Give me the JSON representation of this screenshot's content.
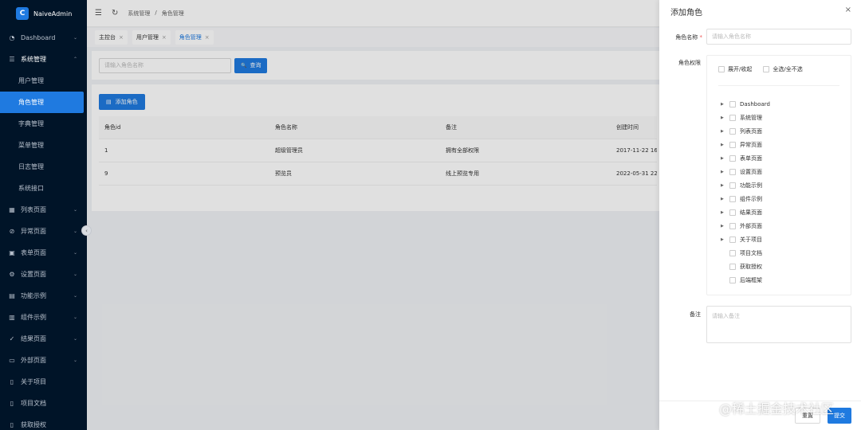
{
  "app": {
    "name": "NaiveAdmin",
    "logo_letter": "C"
  },
  "sidebar": {
    "items": [
      {
        "label": "Dashboard",
        "icon": "dashboard-icon",
        "glyph": "◔",
        "arrow": "⌄"
      },
      {
        "label": "系统管理",
        "icon": "settings-sliders-icon",
        "glyph": "☰",
        "arrow": "⌃",
        "open": true,
        "children": [
          "用户管理",
          "角色管理",
          "字典管理",
          "菜单管理",
          "日志管理",
          "系统接口"
        ],
        "active_child": 1
      },
      {
        "label": "列表页面",
        "icon": "table-icon",
        "glyph": "▦",
        "arrow": "⌄"
      },
      {
        "label": "异常页面",
        "icon": "warning-circle-icon",
        "glyph": "⊘",
        "arrow": "⌄"
      },
      {
        "label": "表单页面",
        "icon": "form-icon",
        "glyph": "▣",
        "arrow": "⌄"
      },
      {
        "label": "设置页面",
        "icon": "gear-icon",
        "glyph": "⚙",
        "arrow": "⌄"
      },
      {
        "label": "功能示例",
        "icon": "function-icon",
        "glyph": "▤",
        "arrow": "⌄"
      },
      {
        "label": "组件示例",
        "icon": "component-icon",
        "glyph": "▥",
        "arrow": "⌄"
      },
      {
        "label": "结果页面",
        "icon": "check-circle-icon",
        "glyph": "✓",
        "arrow": "⌄"
      },
      {
        "label": "外部页面",
        "icon": "monitor-icon",
        "glyph": "▭",
        "arrow": "⌄"
      },
      {
        "label": "关于项目",
        "icon": "book-icon",
        "glyph": "▯",
        "arrow": ""
      },
      {
        "label": "项目文档",
        "icon": "document-icon",
        "glyph": "▯",
        "arrow": ""
      },
      {
        "label": "获取授权",
        "icon": "key-icon",
        "glyph": "▯",
        "arrow": ""
      }
    ],
    "collapse_glyph": "‹"
  },
  "header": {
    "menu_glyph": "☰",
    "refresh_glyph": "↻",
    "breadcrumb": [
      "系统管理",
      "/",
      "角色管理"
    ]
  },
  "tabs": [
    {
      "label": "主控台",
      "active": false
    },
    {
      "label": "用户管理",
      "active": false
    },
    {
      "label": "角色管理",
      "active": true
    }
  ],
  "search": {
    "placeholder": "请输入角色名称",
    "button_label": "查询",
    "button_glyph": "🔍"
  },
  "table": {
    "add_label": "添加角色",
    "add_glyph": "▤",
    "columns": [
      "角色id",
      "角色名称",
      "备注",
      "创建时间"
    ],
    "rows": [
      [
        "1",
        "超级管理员",
        "拥有全部权限",
        "2017-11-22 16:"
      ],
      [
        "9",
        "预览员",
        "线上预览专用",
        "2022-05-31 22:"
      ]
    ]
  },
  "drawer": {
    "title": "添加角色",
    "close_glyph": "×",
    "name_label": "角色名称",
    "name_required": "*",
    "name_placeholder": "请输入角色名称",
    "perm_label": "角色权限",
    "expand_label": "展开/收起",
    "select_all_label": "全选/全不选",
    "tree": [
      {
        "label": "Dashboard",
        "expandable": true
      },
      {
        "label": "系统管理",
        "expandable": true
      },
      {
        "label": "列表页面",
        "expandable": true
      },
      {
        "label": "异常页面",
        "expandable": true
      },
      {
        "label": "表单页面",
        "expandable": true
      },
      {
        "label": "设置页面",
        "expandable": true
      },
      {
        "label": "功能示例",
        "expandable": true
      },
      {
        "label": "组件示例",
        "expandable": true
      },
      {
        "label": "结果页面",
        "expandable": true
      },
      {
        "label": "外部页面",
        "expandable": true
      },
      {
        "label": "关于项目",
        "expandable": true
      },
      {
        "label": "项目文档",
        "expandable": false
      },
      {
        "label": "获取授权",
        "expandable": false
      },
      {
        "label": "后端框架",
        "expandable": false
      }
    ],
    "note_label": "备注",
    "note_placeholder": "请输入备注",
    "reset_label": "重置",
    "submit_label": "提交"
  },
  "watermark": "@稀土掘金技术社区",
  "colors": {
    "primary": "#1f7ae0",
    "sidebar_bg": "#001428"
  }
}
